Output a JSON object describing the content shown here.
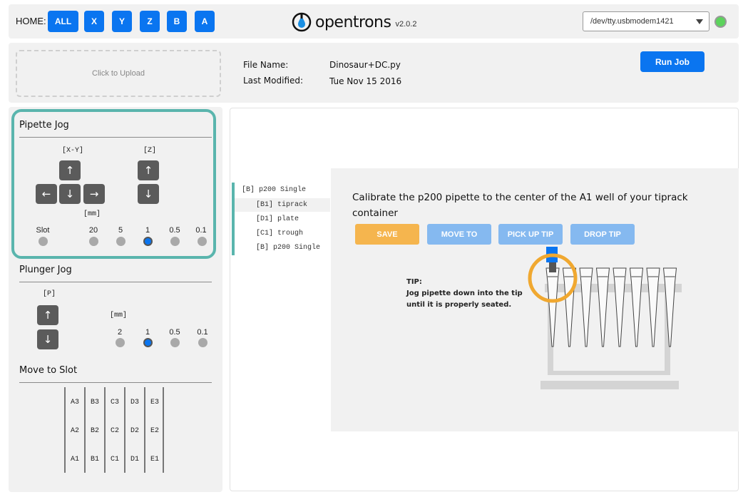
{
  "header": {
    "home_label": "HOME:",
    "home_buttons": [
      "ALL",
      "X",
      "Y",
      "Z",
      "B",
      "A"
    ],
    "logo_text": "opentrons",
    "version": "v2.0.2",
    "port": "/dev/tty.usbmodem1421",
    "status_color": "#5cd35c"
  },
  "upload": {
    "zone_label": "Click to Upload",
    "file_name_label": "File Name:",
    "file_name": "Dinosaur+DC.py",
    "last_modified_label": "Last Modified:",
    "last_modified": "Tue Nov 15 2016",
    "run_job": "Run Job"
  },
  "pipette_jog": {
    "title": "Pipette Jog",
    "xy_label": "[X-Y]",
    "z_label": "[Z]",
    "mm_label": "[mm]",
    "slot_label": "Slot",
    "steps": [
      "20",
      "5",
      "1",
      "0.5",
      "0.1"
    ],
    "selected_step": "1",
    "arrows": {
      "up": "↑",
      "down": "↓",
      "left": "←",
      "right": "→"
    }
  },
  "plunger_jog": {
    "title": "Plunger Jog",
    "p_label": "[P]",
    "mm_label": "[mm]",
    "steps": [
      "2",
      "1",
      "0.5",
      "0.1"
    ],
    "selected_step": "1"
  },
  "move_to_slot": {
    "title": "Move to Slot",
    "columns": [
      [
        "A3",
        "A2",
        "A1"
      ],
      [
        "B3",
        "B2",
        "B1"
      ],
      [
        "C3",
        "C2",
        "C1"
      ],
      [
        "D3",
        "D2",
        "D1"
      ],
      [
        "E3",
        "E2",
        "E1"
      ]
    ]
  },
  "nav": {
    "items": [
      "[B] p200 Single",
      "[B1] tiprack",
      "[D1] plate",
      "[C1] trough",
      "[B] p200 Single"
    ],
    "active_index": 1
  },
  "calibration": {
    "message": "Calibrate the p200 pipette to the center of the A1 well of your tiprack container",
    "buttons": [
      "SAVE",
      "MOVE TO",
      "PICK UP TIP",
      "DROP TIP"
    ],
    "save_color": "#f5b54e",
    "secondary_color": "#85b9f0",
    "tip_title": "TIP:",
    "tip_line1": "Jog pipette down into the tip",
    "tip_line2": "until it is properly seated.",
    "highlight_color": "#f0a830"
  }
}
